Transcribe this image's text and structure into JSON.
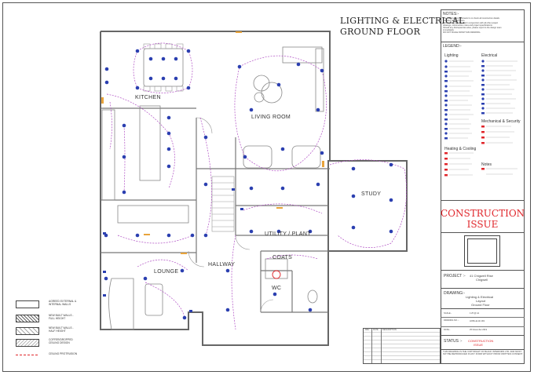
{
  "title": {
    "line1": "LIGHTING & ELECTRICAL",
    "line2": "GROUND FLOOR"
  },
  "notes": {
    "heading": "NOTES:-",
    "lines": [
      "The main building contractor is to check all construction details",
      "including all dimensions.",
      "This drawing is to be read in conjunction with all other project",
      "drawings, construction notes and project specifications.",
      "Should any discrepancies arise, please report to the design team",
      "immediately.",
      "DO NOT SCALE FROM THIS DRAWING."
    ]
  },
  "legend": {
    "heading": "LEGEND:-",
    "lighting_heading": "Lighting",
    "electrical_heading": "Electrical",
    "mech_heading": "Mechanical & Security",
    "heating_heading": "Heating & Cooling",
    "notes_heading": "Notes"
  },
  "construction_issue": {
    "line1": "CONSTRUCTION",
    "line2": "ISSUE"
  },
  "project": {
    "label": "PROJECT :-",
    "value_line1": "41 Chigwell Rise",
    "value_line2": "Chigwell"
  },
  "drawing": {
    "label": "DRAWING:-",
    "value_line1": "Lighting & Electrical",
    "value_line2": "Layout",
    "value_line3": "Ground Floor"
  },
  "scale": {
    "label": "SCALE:-",
    "value": "1:25 @ A1"
  },
  "drawing_no": {
    "label": "DRAWING NO.:-",
    "value": "HOB-LE-GF-001"
  },
  "date": {
    "label": "DATE:-",
    "value": "25 November 2019"
  },
  "revisions": {
    "col_rev": "REV",
    "col_date": "DATE",
    "col_desc": "DESCRIPTION"
  },
  "status": {
    "label": "STATUS :-",
    "value_line1": "CONSTRUCTION",
    "value_line2": "ISSUE"
  },
  "copyright": "THIS DRAWING IS THE COPYRIGHT OF BLACK INTERIORS LTD. AND MUST NOT BE REPRODUCED IN ANY FORM WITHOUT PRIOR WRITTEN CONSENT.",
  "rooms": {
    "kitchen": "KITCHEN",
    "living": "LIVING ROOM",
    "study": "STUDY",
    "utility": "UTILITY / PLANT",
    "hallway": "HALLWAY",
    "lounge": "LOUNGE",
    "coats": "COATS",
    "wc": "WC"
  },
  "wall_key": {
    "agreed_line1": "AGREED EXTERNAL &",
    "agreed_line2": "INTERNAL WALLS",
    "new_full_line1": "NEW BUILT WALLS -",
    "new_full_line2": "FULL HEIGHT",
    "new_half_line1": "NEW BUILT WALLS -",
    "new_half_line2": "HALF HEIGHT",
    "ceiling_line1": "COFFER/DROPPED",
    "ceiling_line2": "CEILING DESIGN",
    "protrusion": "CEILING PROTRUSION"
  },
  "colors": {
    "symbol": "#2b3fb0",
    "circuit": "#b04fc4",
    "construction": "#e0262b",
    "wall": "#666666"
  }
}
